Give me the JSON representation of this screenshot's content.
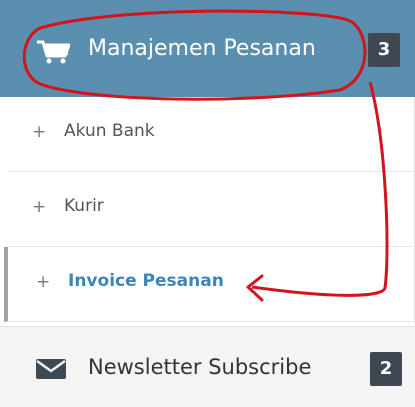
{
  "header": {
    "icon": "shopping-cart-icon",
    "title": "Manajemen Pesanan",
    "badge": "3"
  },
  "submenu": {
    "items": [
      {
        "icon": "plus-icon",
        "bullet": "+",
        "label": "Akun Bank"
      },
      {
        "icon": "plus-icon",
        "bullet": "+",
        "label": "Kurir"
      },
      {
        "icon": "plus-icon",
        "bullet": "+",
        "label": "Invoice Pesanan",
        "active": true
      }
    ]
  },
  "footer": {
    "icon": "envelope-icon",
    "title": "Newsletter Subscribe",
    "badge": "2"
  },
  "colors": {
    "header_bg": "#5b8fb0",
    "badge_bg": "#3d4852",
    "active_text": "#3a86b8",
    "annotation": "#d4141c"
  }
}
